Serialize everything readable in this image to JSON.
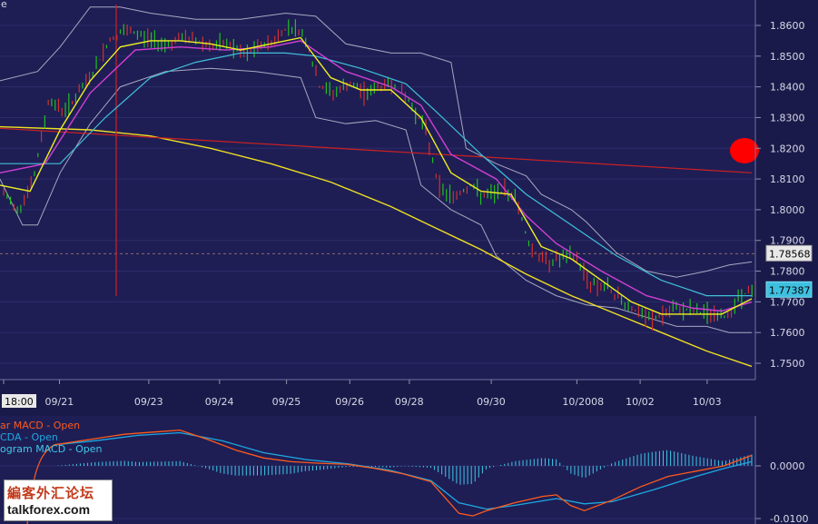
{
  "topbar_text": "e",
  "chart_data": [
    {
      "type": "line",
      "instrument_panel": "price",
      "y_ticks": [
        "1.8600",
        "1.8500",
        "1.8400",
        "1.8300",
        "1.8200",
        "1.8100",
        "1.8000",
        "1.7900",
        "1.7800",
        "1.7700",
        "1.7600",
        "1.7500"
      ],
      "ylim": [
        1.745,
        1.868
      ],
      "x_ticks": [
        "18:00",
        "09/21",
        "09/23",
        "09/24",
        "09/25",
        "09/26",
        "09/28",
        "09/30",
        "10/2008",
        "10/02",
        "10/03"
      ],
      "current_price_label": "1.78568",
      "current_price": 1.78568,
      "ma_price_label": "1.77387",
      "ma_price": 1.77387,
      "price_path": [
        [
          0,
          1.805
        ],
        [
          0.02,
          1.8
        ],
        [
          0.04,
          1.81
        ],
        [
          0.06,
          1.836
        ],
        [
          0.08,
          1.832
        ],
        [
          0.1,
          1.838
        ],
        [
          0.12,
          1.845
        ],
        [
          0.14,
          1.855
        ],
        [
          0.16,
          1.858
        ],
        [
          0.18,
          1.857
        ],
        [
          0.2,
          1.855
        ],
        [
          0.22,
          1.854
        ],
        [
          0.24,
          1.856
        ],
        [
          0.26,
          1.855
        ],
        [
          0.28,
          1.853
        ],
        [
          0.3,
          1.854
        ],
        [
          0.32,
          1.85
        ],
        [
          0.34,
          1.853
        ],
        [
          0.36,
          1.855
        ],
        [
          0.38,
          1.86
        ],
        [
          0.4,
          1.857
        ],
        [
          0.42,
          1.84
        ],
        [
          0.44,
          1.838
        ],
        [
          0.46,
          1.841
        ],
        [
          0.48,
          1.838
        ],
        [
          0.5,
          1.84
        ],
        [
          0.52,
          1.841
        ],
        [
          0.54,
          1.835
        ],
        [
          0.56,
          1.827
        ],
        [
          0.58,
          1.807
        ],
        [
          0.6,
          1.804
        ],
        [
          0.62,
          1.808
        ],
        [
          0.64,
          1.804
        ],
        [
          0.66,
          1.806
        ],
        [
          0.68,
          1.805
        ],
        [
          0.7,
          1.788
        ],
        [
          0.72,
          1.783
        ],
        [
          0.74,
          1.784
        ],
        [
          0.76,
          1.785
        ],
        [
          0.78,
          1.776
        ],
        [
          0.8,
          1.775
        ],
        [
          0.82,
          1.771
        ],
        [
          0.84,
          1.767
        ],
        [
          0.86,
          1.764
        ],
        [
          0.88,
          1.766
        ],
        [
          0.9,
          1.768
        ],
        [
          0.92,
          1.767
        ],
        [
          0.94,
          1.766
        ],
        [
          0.96,
          1.765
        ],
        [
          0.98,
          1.772
        ],
        [
          1.0,
          1.774
        ]
      ],
      "ma_fast": [
        [
          0,
          1.808
        ],
        [
          0.04,
          1.806
        ],
        [
          0.08,
          1.826
        ],
        [
          0.12,
          1.842
        ],
        [
          0.16,
          1.853
        ],
        [
          0.2,
          1.855
        ],
        [
          0.24,
          1.855
        ],
        [
          0.28,
          1.854
        ],
        [
          0.32,
          1.852
        ],
        [
          0.36,
          1.854
        ],
        [
          0.4,
          1.856
        ],
        [
          0.44,
          1.843
        ],
        [
          0.48,
          1.839
        ],
        [
          0.52,
          1.839
        ],
        [
          0.56,
          1.83
        ],
        [
          0.6,
          1.812
        ],
        [
          0.64,
          1.806
        ],
        [
          0.68,
          1.805
        ],
        [
          0.72,
          1.788
        ],
        [
          0.76,
          1.784
        ],
        [
          0.8,
          1.777
        ],
        [
          0.84,
          1.77
        ],
        [
          0.88,
          1.766
        ],
        [
          0.92,
          1.766
        ],
        [
          0.96,
          1.766
        ],
        [
          1.0,
          1.771
        ]
      ],
      "ma_mid": [
        [
          0,
          1.812
        ],
        [
          0.06,
          1.815
        ],
        [
          0.12,
          1.838
        ],
        [
          0.18,
          1.852
        ],
        [
          0.24,
          1.853
        ],
        [
          0.3,
          1.852
        ],
        [
          0.36,
          1.853
        ],
        [
          0.4,
          1.855
        ],
        [
          0.46,
          1.845
        ],
        [
          0.52,
          1.84
        ],
        [
          0.56,
          1.834
        ],
        [
          0.6,
          1.818
        ],
        [
          0.66,
          1.81
        ],
        [
          0.7,
          1.798
        ],
        [
          0.74,
          1.789
        ],
        [
          0.8,
          1.78
        ],
        [
          0.86,
          1.772
        ],
        [
          0.92,
          1.768
        ],
        [
          0.96,
          1.767
        ],
        [
          1.0,
          1.77
        ]
      ],
      "ma_slow": [
        [
          0,
          1.815
        ],
        [
          0.08,
          1.815
        ],
        [
          0.14,
          1.83
        ],
        [
          0.2,
          1.843
        ],
        [
          0.26,
          1.848
        ],
        [
          0.32,
          1.851
        ],
        [
          0.38,
          1.851
        ],
        [
          0.42,
          1.85
        ],
        [
          0.48,
          1.846
        ],
        [
          0.54,
          1.841
        ],
        [
          0.58,
          1.832
        ],
        [
          0.64,
          1.818
        ],
        [
          0.7,
          1.805
        ],
        [
          0.76,
          1.795
        ],
        [
          0.82,
          1.785
        ],
        [
          0.88,
          1.777
        ],
        [
          0.94,
          1.772
        ],
        [
          1.0,
          1.772
        ]
      ],
      "bollinger_upper": [
        [
          0,
          1.842
        ],
        [
          0.05,
          1.845
        ],
        [
          0.08,
          1.853
        ],
        [
          0.12,
          1.866
        ],
        [
          0.16,
          1.866
        ],
        [
          0.2,
          1.864
        ],
        [
          0.26,
          1.862
        ],
        [
          0.32,
          1.862
        ],
        [
          0.38,
          1.864
        ],
        [
          0.42,
          1.863
        ],
        [
          0.46,
          1.854
        ],
        [
          0.52,
          1.851
        ],
        [
          0.56,
          1.851
        ],
        [
          0.6,
          1.848
        ],
        [
          0.62,
          1.82
        ],
        [
          0.66,
          1.815
        ],
        [
          0.7,
          1.811
        ],
        [
          0.72,
          1.805
        ],
        [
          0.76,
          1.8
        ],
        [
          0.78,
          1.796
        ],
        [
          0.82,
          1.786
        ],
        [
          0.86,
          1.78
        ],
        [
          0.9,
          1.778
        ],
        [
          0.94,
          1.78
        ],
        [
          0.97,
          1.782
        ],
        [
          1.0,
          1.783
        ]
      ],
      "bollinger_lower": [
        [
          0,
          1.81
        ],
        [
          0.03,
          1.795
        ],
        [
          0.05,
          1.795
        ],
        [
          0.08,
          1.812
        ],
        [
          0.12,
          1.828
        ],
        [
          0.16,
          1.84
        ],
        [
          0.22,
          1.845
        ],
        [
          0.28,
          1.846
        ],
        [
          0.34,
          1.845
        ],
        [
          0.4,
          1.843
        ],
        [
          0.42,
          1.83
        ],
        [
          0.46,
          1.828
        ],
        [
          0.5,
          1.829
        ],
        [
          0.54,
          1.826
        ],
        [
          0.56,
          1.808
        ],
        [
          0.6,
          1.8
        ],
        [
          0.64,
          1.795
        ],
        [
          0.66,
          1.785
        ],
        [
          0.7,
          1.777
        ],
        [
          0.74,
          1.772
        ],
        [
          0.78,
          1.769
        ],
        [
          0.82,
          1.768
        ],
        [
          0.86,
          1.765
        ],
        [
          0.9,
          1.762
        ],
        [
          0.94,
          1.762
        ],
        [
          0.97,
          1.76
        ],
        [
          1.0,
          1.76
        ]
      ],
      "red_trendline": [
        [
          0,
          1.8265
        ],
        [
          1.0,
          1.812
        ]
      ],
      "yellow_curve": [
        [
          0,
          1.827
        ],
        [
          0.12,
          1.826
        ],
        [
          0.2,
          1.824
        ],
        [
          0.28,
          1.82
        ],
        [
          0.36,
          1.815
        ],
        [
          0.44,
          1.809
        ],
        [
          0.52,
          1.801
        ],
        [
          0.58,
          1.794
        ],
        [
          0.64,
          1.787
        ],
        [
          0.7,
          1.779
        ],
        [
          0.76,
          1.772
        ],
        [
          0.82,
          1.766
        ],
        [
          0.88,
          1.76
        ],
        [
          0.94,
          1.754
        ],
        [
          1.0,
          1.749
        ]
      ],
      "red_marker": {
        "price": 1.8192,
        "color": "#ff0000"
      }
    },
    {
      "type": "line",
      "instrument_panel": "macd",
      "legend": [
        {
          "label": "ar MACD - Open",
          "color": "#ff5a1a"
        },
        {
          "label": "CDA - Open",
          "color": "#1ea8e0"
        },
        {
          "label": "ogram MACD - Open",
          "color": "#40c8e8"
        }
      ],
      "y_ticks": [
        "0.0000",
        "-0.0100"
      ],
      "ylim": [
        -0.0105,
        0.0075
      ],
      "macd": [
        [
          0,
          0.004
        ],
        [
          0.05,
          0.005
        ],
        [
          0.1,
          0.006
        ],
        [
          0.15,
          0.0065
        ],
        [
          0.18,
          0.0068
        ],
        [
          0.22,
          0.005
        ],
        [
          0.26,
          0.003
        ],
        [
          0.3,
          0.0015
        ],
        [
          0.34,
          0.0008
        ],
        [
          0.38,
          0.0005
        ],
        [
          0.42,
          0.0003
        ],
        [
          0.46,
          -0.0005
        ],
        [
          0.5,
          -0.0015
        ],
        [
          0.54,
          -0.003
        ],
        [
          0.56,
          -0.006
        ],
        [
          0.58,
          -0.009
        ],
        [
          0.6,
          -0.0095
        ],
        [
          0.62,
          -0.0085
        ],
        [
          0.66,
          -0.007
        ],
        [
          0.7,
          -0.0058
        ],
        [
          0.72,
          -0.0055
        ],
        [
          0.74,
          -0.0075
        ],
        [
          0.76,
          -0.0085
        ],
        [
          0.8,
          -0.0065
        ],
        [
          0.84,
          -0.004
        ],
        [
          0.88,
          -0.002
        ],
        [
          0.92,
          -0.001
        ],
        [
          0.96,
          0
        ],
        [
          1.0,
          0.002
        ]
      ],
      "signal": [
        [
          0,
          0.004
        ],
        [
          0.06,
          0.0048
        ],
        [
          0.12,
          0.0058
        ],
        [
          0.18,
          0.0063
        ],
        [
          0.24,
          0.0048
        ],
        [
          0.3,
          0.0025
        ],
        [
          0.36,
          0.0012
        ],
        [
          0.42,
          0.0004
        ],
        [
          0.48,
          -0.0008
        ],
        [
          0.54,
          -0.0028
        ],
        [
          0.58,
          -0.007
        ],
        [
          0.62,
          -0.0082
        ],
        [
          0.66,
          -0.0075
        ],
        [
          0.72,
          -0.0062
        ],
        [
          0.76,
          -0.0072
        ],
        [
          0.8,
          -0.0068
        ],
        [
          0.86,
          -0.0045
        ],
        [
          0.92,
          -0.002
        ],
        [
          0.96,
          -0.0005
        ],
        [
          1.0,
          0.0008
        ]
      ]
    }
  ],
  "watermark": {
    "cn": "編客外汇论坛",
    "en": "talkforex.com"
  }
}
